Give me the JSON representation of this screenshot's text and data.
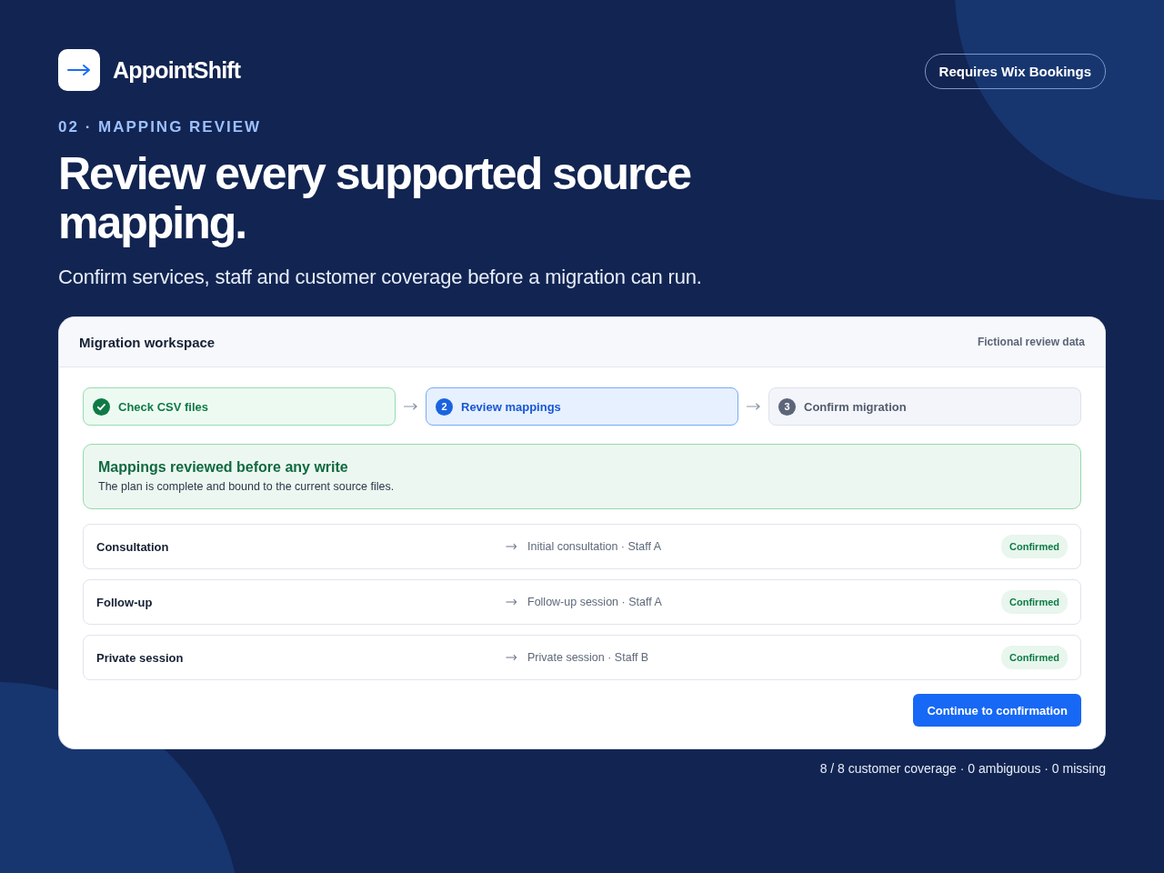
{
  "brand": {
    "name": "AppointShift"
  },
  "requirement_badge": "Requires Wix Bookings",
  "eyebrow": "02 · MAPPING REVIEW",
  "headline": "Review every supported source mapping.",
  "subtitle": "Confirm services, staff and customer coverage before a migration can run.",
  "workspace": {
    "title": "Migration workspace",
    "note": "Fictional review data",
    "steps": [
      {
        "label": "Check CSV files",
        "kind": "done"
      },
      {
        "label": "Review mappings",
        "kind": "current",
        "number": "2"
      },
      {
        "label": "Confirm migration",
        "kind": "upcoming",
        "number": "3"
      }
    ],
    "notice": {
      "title": "Mappings reviewed before any write",
      "text": "The plan is complete and bound to the current source files."
    },
    "mappings": [
      {
        "source": "Consultation",
        "target": "Initial consultation · Staff A",
        "status": "Confirmed"
      },
      {
        "source": "Follow-up",
        "target": "Follow-up session · Staff A",
        "status": "Confirmed"
      },
      {
        "source": "Private session",
        "target": "Private session · Staff B",
        "status": "Confirmed"
      }
    ],
    "primary_button": "Continue to confirmation"
  },
  "coverage_summary": "8 / 8 customer coverage · 0 ambiguous · 0 missing"
}
